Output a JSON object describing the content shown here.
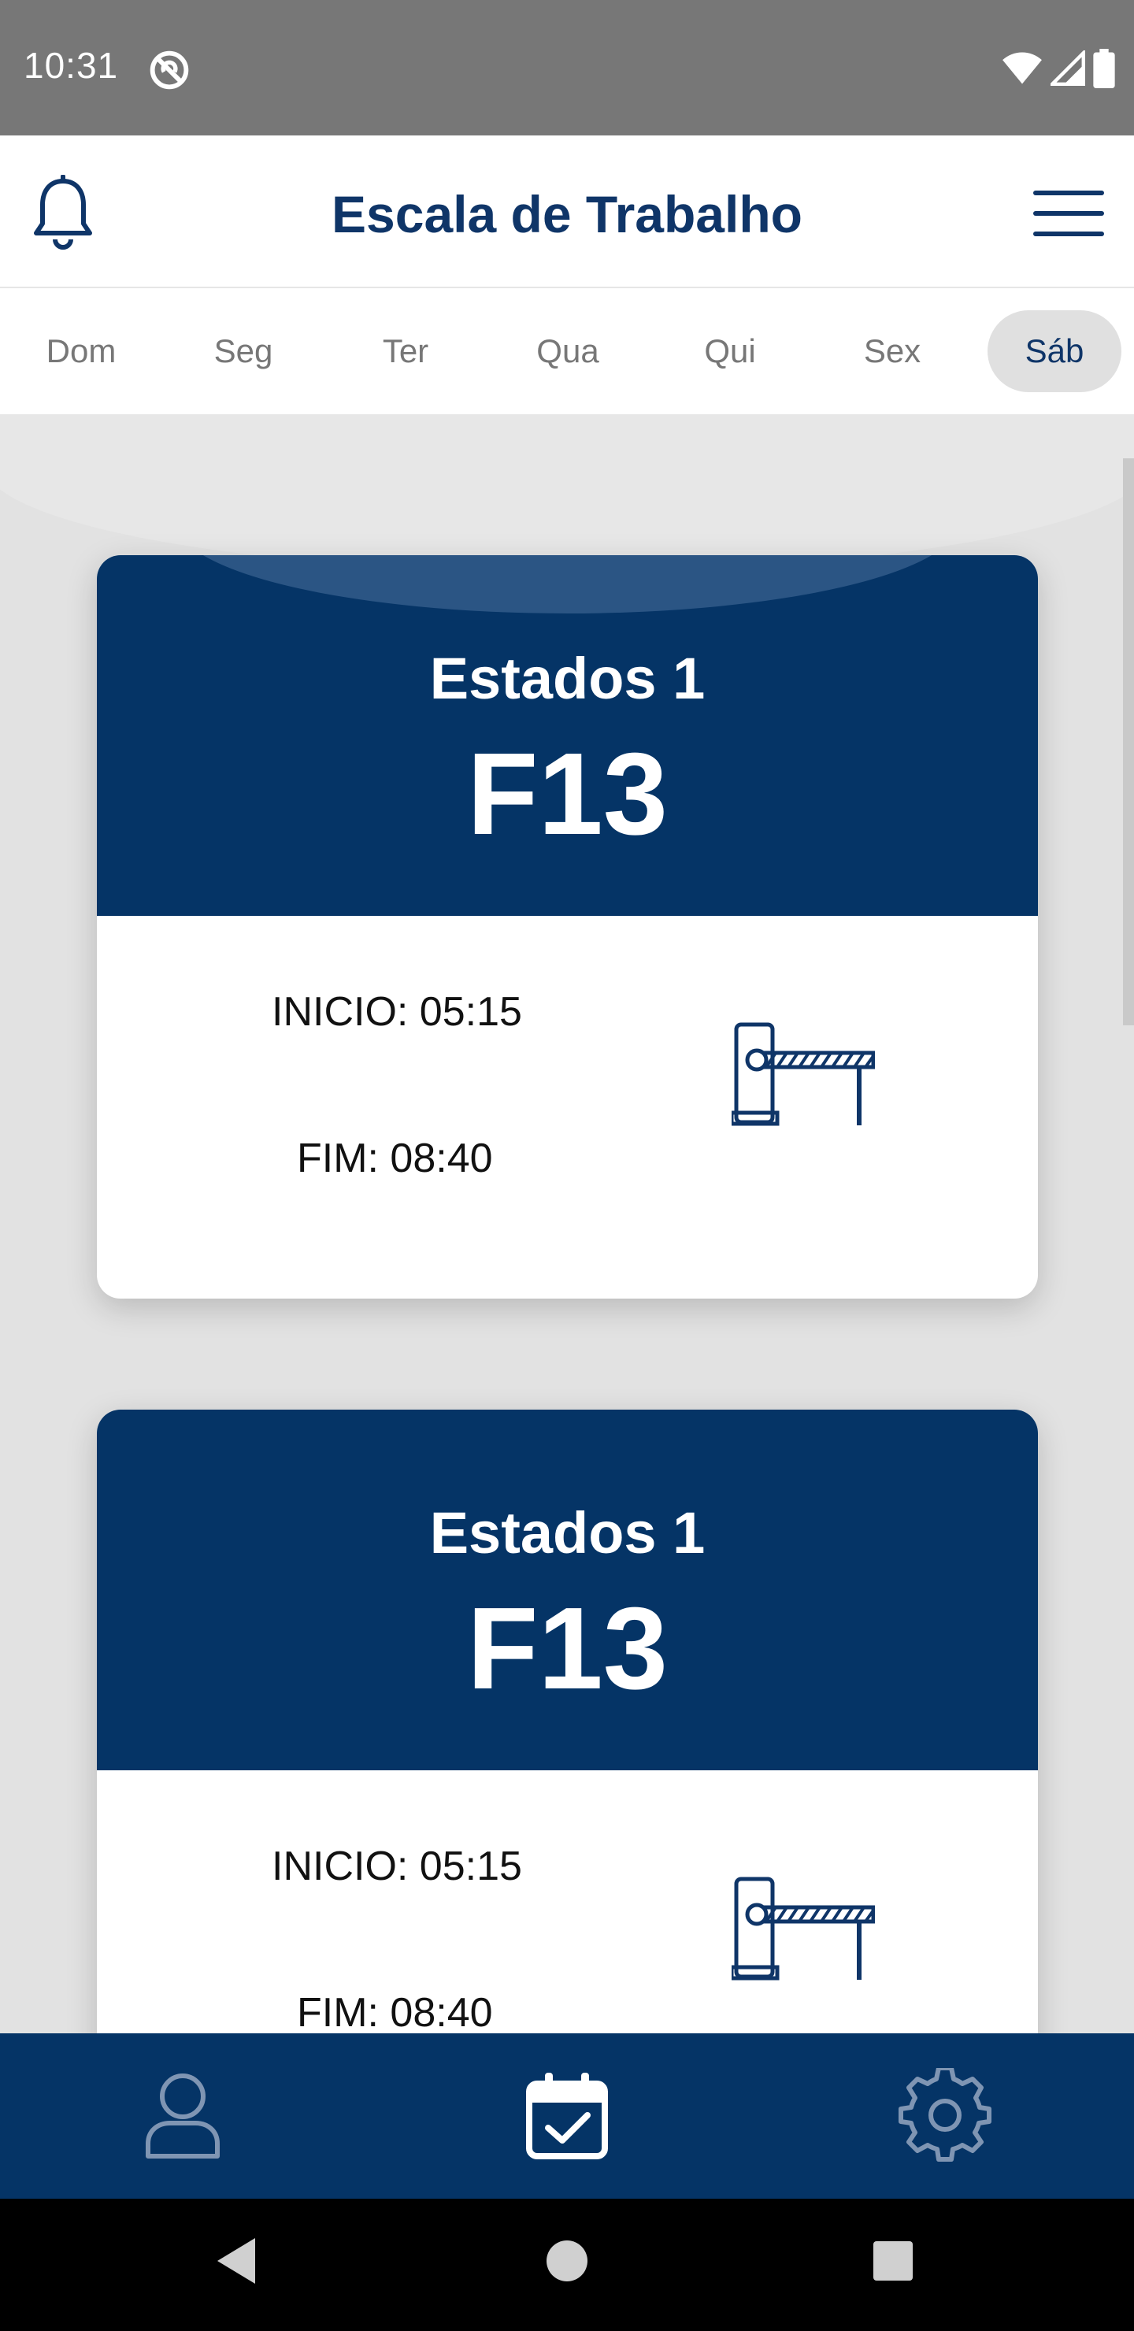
{
  "status_bar": {
    "time": "10:31"
  },
  "header": {
    "title": "Escala de Trabalho"
  },
  "days": [
    "Dom",
    "Seg",
    "Ter",
    "Qua",
    "Qui",
    "Sex",
    "Sáb"
  ],
  "selected_day": "Sáb",
  "cards": [
    {
      "name": "Estados 1",
      "code": "F13",
      "start": "INICIO: 05:15",
      "end": "FIM: 08:40",
      "icon": "barrier-gate-icon"
    },
    {
      "name": "Estados 1",
      "code": "F13",
      "start": "INICIO: 05:15",
      "end": "FIM: 08:40",
      "icon": "barrier-gate-icon"
    }
  ],
  "bottom_nav": [
    {
      "icon": "user-icon"
    },
    {
      "icon": "calendar-check-icon",
      "active": true
    },
    {
      "icon": "gear-icon"
    }
  ],
  "colors": {
    "primary": "#053466",
    "title": "#0f3568",
    "background": "#e2e2e2",
    "status_bar": "#777777"
  }
}
